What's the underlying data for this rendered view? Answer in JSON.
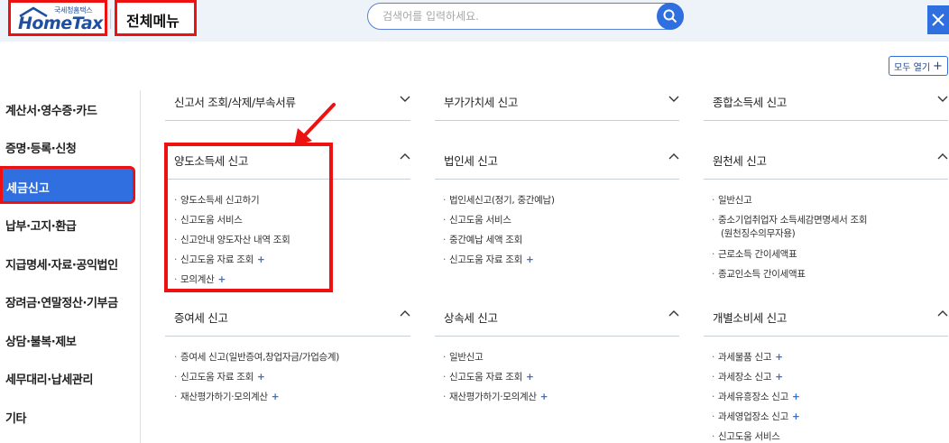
{
  "header": {
    "logo_small": "국세청홈택스",
    "logo_text": "HomeTax",
    "menu_title": "전체메뉴",
    "search_placeholder": "검색어를 입력하세요."
  },
  "toolbar": {
    "open_all_label": "모두 열기",
    "open_all_icon": "plus-icon"
  },
  "sidebar": {
    "items": [
      {
        "label": "계산서·영수증·카드"
      },
      {
        "label": "증명·등록·신청"
      },
      {
        "label": "세금신고",
        "active": true
      },
      {
        "label": "납부·고지·환급"
      },
      {
        "label": "지급명세·자료·공익법인"
      },
      {
        "label": "장려금·연말정산·기부금"
      },
      {
        "label": "상담·불복·제보"
      },
      {
        "label": "세무대리·납세관리"
      },
      {
        "label": "기타"
      }
    ]
  },
  "sections": {
    "s1": {
      "title": "신고서 조회/삭제/부속서류",
      "state": "collapsed"
    },
    "s2": {
      "title": "부가가치세 신고",
      "state": "collapsed"
    },
    "s3": {
      "title": "종합소득세 신고",
      "state": "collapsed"
    },
    "s4": {
      "title": "양도소득세 신고",
      "state": "expanded",
      "items": [
        "양도소득세 신고하기",
        "신고도움 서비스",
        "신고안내 양도자산 내역 조회",
        "신고도움 자료 조회",
        "모의계산"
      ]
    },
    "s5": {
      "title": "법인세 신고",
      "state": "expanded",
      "items": [
        "법인세신고(정기, 중간예납)",
        "신고도움 서비스",
        "중간예납 세액 조회",
        "신고도움 자료 조회"
      ]
    },
    "s6": {
      "title": "원천세 신고",
      "state": "expanded",
      "items": [
        "일반신고",
        "중소기업취업자 소득세감면명세서 조회",
        "(원천징수의무자용)",
        "근로소득 간이세액표",
        "종교인소득 간이세액표"
      ]
    },
    "s7": {
      "title": "증여세 신고",
      "state": "expanded",
      "items": [
        "증여세 신고(일반증여,창업자금/가업승계)",
        "신고도움 자료 조회",
        "재산평가하기·모의계산"
      ]
    },
    "s8": {
      "title": "상속세 신고",
      "state": "expanded",
      "items": [
        "일반신고",
        "신고도움 자료 조회",
        "재산평가하기·모의계산"
      ]
    },
    "s9": {
      "title": "개별소비세 신고",
      "state": "expanded",
      "items": [
        "과세물품 신고",
        "과세장소 신고",
        "과세유흥장소 신고",
        "과세영업장소 신고",
        "신고도움 서비스"
      ]
    }
  },
  "colors": {
    "accent": "#2f6fe0",
    "highlight": "#e11111",
    "header_bg": "#eef2f9"
  }
}
